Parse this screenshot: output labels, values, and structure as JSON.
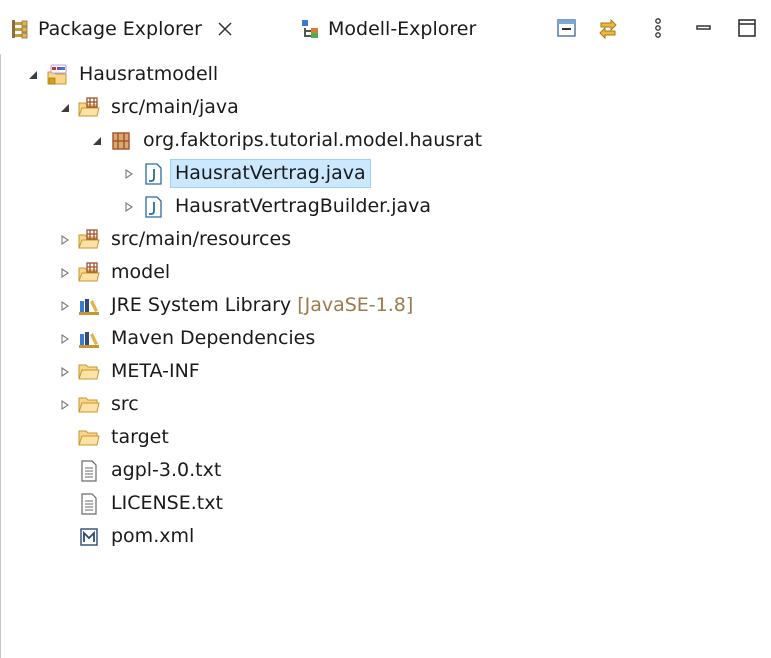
{
  "tabs": [
    {
      "label": "Package Explorer",
      "icon": "package-explorer-icon",
      "active": true
    },
    {
      "label": "Modell-Explorer",
      "icon": "model-explorer-icon",
      "active": false
    }
  ],
  "toolbar": {
    "collapse_all": "collapse-all-icon",
    "link_with_editor": "link-with-editor-icon",
    "view_menu": "view-menu-icon",
    "minimize": "minimize-icon",
    "maximize": "maximize-icon"
  },
  "tree": [
    {
      "label": "Hausratmodell",
      "icon": "faktorips-project-icon",
      "state": "expanded",
      "depth": 0
    },
    {
      "label": "src/main/java",
      "icon": "source-folder-icon",
      "state": "expanded",
      "depth": 1
    },
    {
      "label": "org.faktorips.tutorial.model.hausrat",
      "icon": "package-icon",
      "state": "expanded",
      "depth": 2
    },
    {
      "label": "HausratVertrag.java",
      "icon": "java-file-icon",
      "state": "collapsed",
      "depth": 3,
      "selected": true
    },
    {
      "label": "HausratVertragBuilder.java",
      "icon": "java-file-icon",
      "state": "collapsed",
      "depth": 3
    },
    {
      "label": "src/main/resources",
      "icon": "source-folder-icon",
      "state": "collapsed",
      "depth": 1
    },
    {
      "label": "model",
      "icon": "source-folder-icon",
      "state": "collapsed",
      "depth": 1
    },
    {
      "label": "JRE System Library",
      "decoration": "[JavaSE-1.8]",
      "icon": "library-icon",
      "state": "collapsed",
      "depth": 1
    },
    {
      "label": "Maven Dependencies",
      "icon": "library-icon",
      "state": "collapsed",
      "depth": 1
    },
    {
      "label": "META-INF",
      "icon": "folder-icon",
      "state": "collapsed",
      "depth": 1
    },
    {
      "label": "src",
      "icon": "folder-icon",
      "state": "collapsed",
      "depth": 1
    },
    {
      "label": "target",
      "icon": "folder-icon",
      "state": "leaf",
      "depth": 1
    },
    {
      "label": "agpl-3.0.txt",
      "icon": "text-file-icon",
      "state": "leaf",
      "depth": 1
    },
    {
      "label": "LICENSE.txt",
      "icon": "text-file-icon",
      "state": "leaf",
      "depth": 1
    },
    {
      "label": "pom.xml",
      "icon": "maven-pom-icon",
      "state": "leaf",
      "depth": 1
    }
  ],
  "colors": {
    "selection_bg": "#cce8ff",
    "selection_border": "#99d1ff",
    "decoration_text": "#9c7a4a",
    "folder_fill": "#f7d58a",
    "folder_stroke": "#c8962e",
    "package_brown": "#a0522d",
    "java_blue": "#2a6aa8"
  }
}
